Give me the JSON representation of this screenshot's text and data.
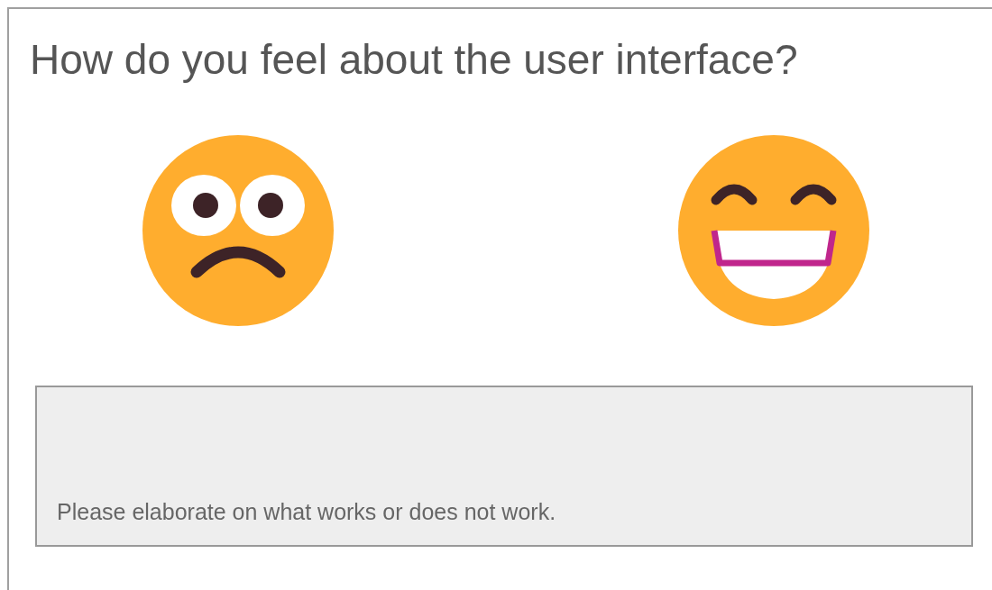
{
  "question": {
    "title": "How do you feel about the user interface?"
  },
  "faces": [
    {
      "kind": "sad"
    },
    {
      "kind": "happy"
    }
  ],
  "comment": {
    "placeholder": "Please elaborate on what works or does not work."
  }
}
